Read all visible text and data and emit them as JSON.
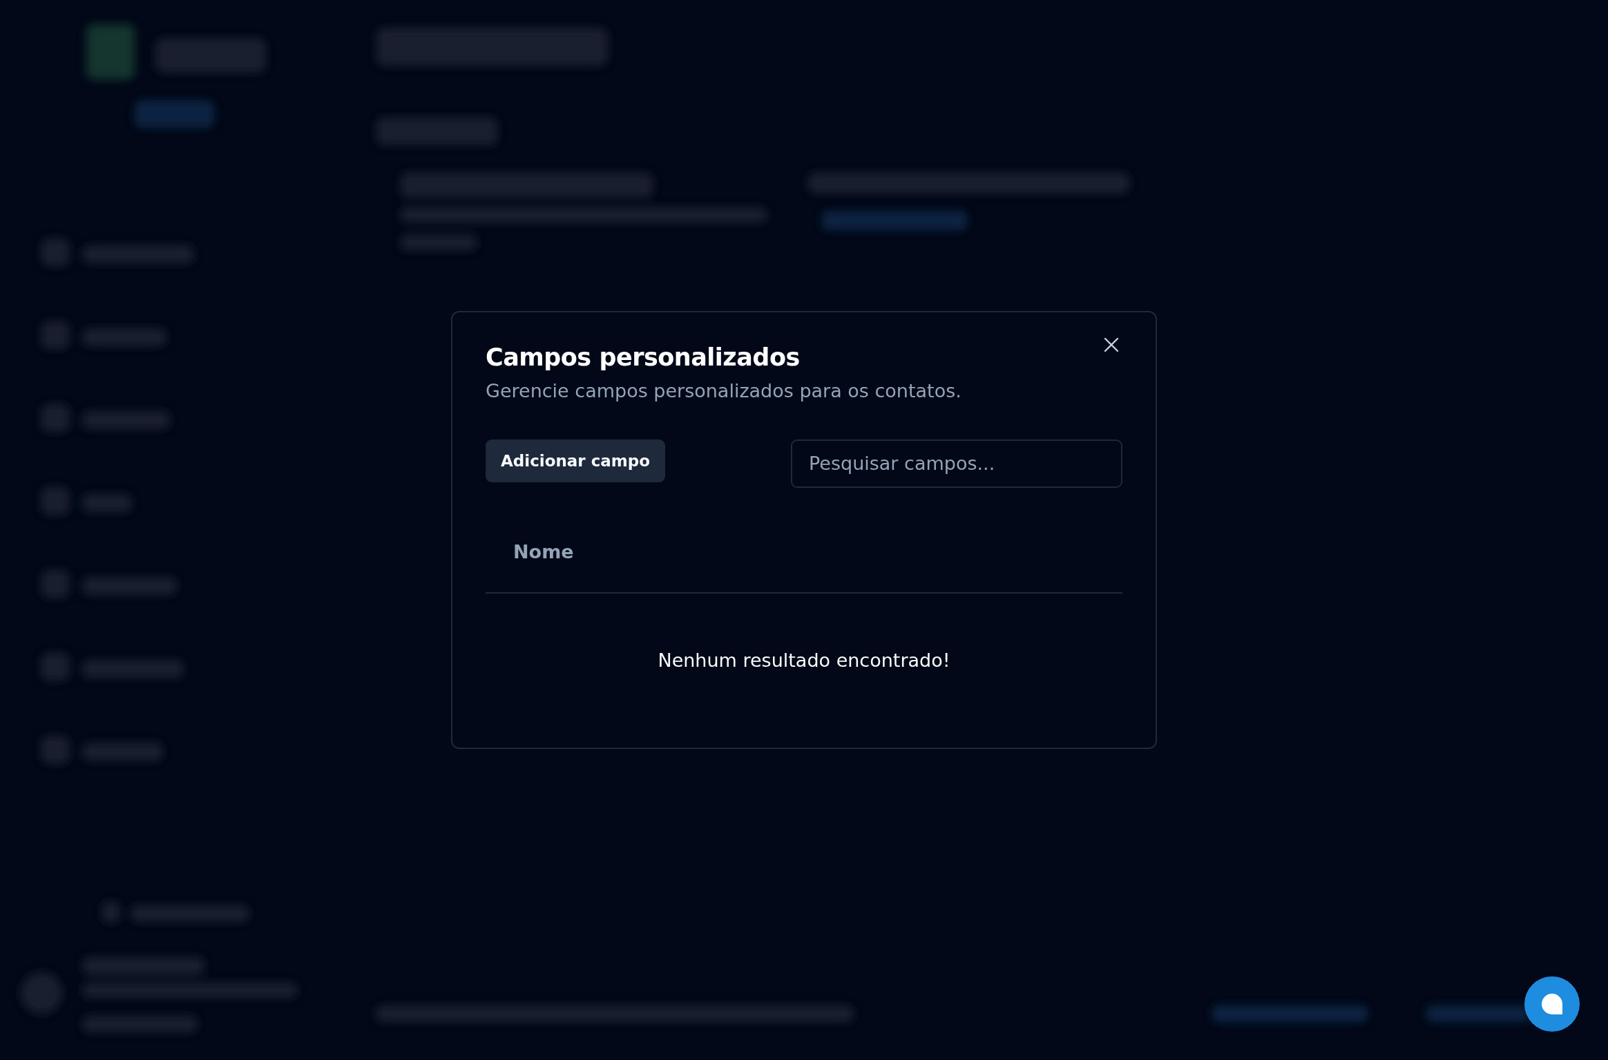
{
  "dialog": {
    "title": "Campos personalizados",
    "description": "Gerencie campos personalizados para os contatos.",
    "add_button": "Adicionar campo",
    "search": {
      "placeholder": "Pesquisar campos..."
    },
    "table": {
      "columns": [
        "Nome"
      ],
      "empty_message": "Nenhum resultado encontrado!"
    }
  }
}
